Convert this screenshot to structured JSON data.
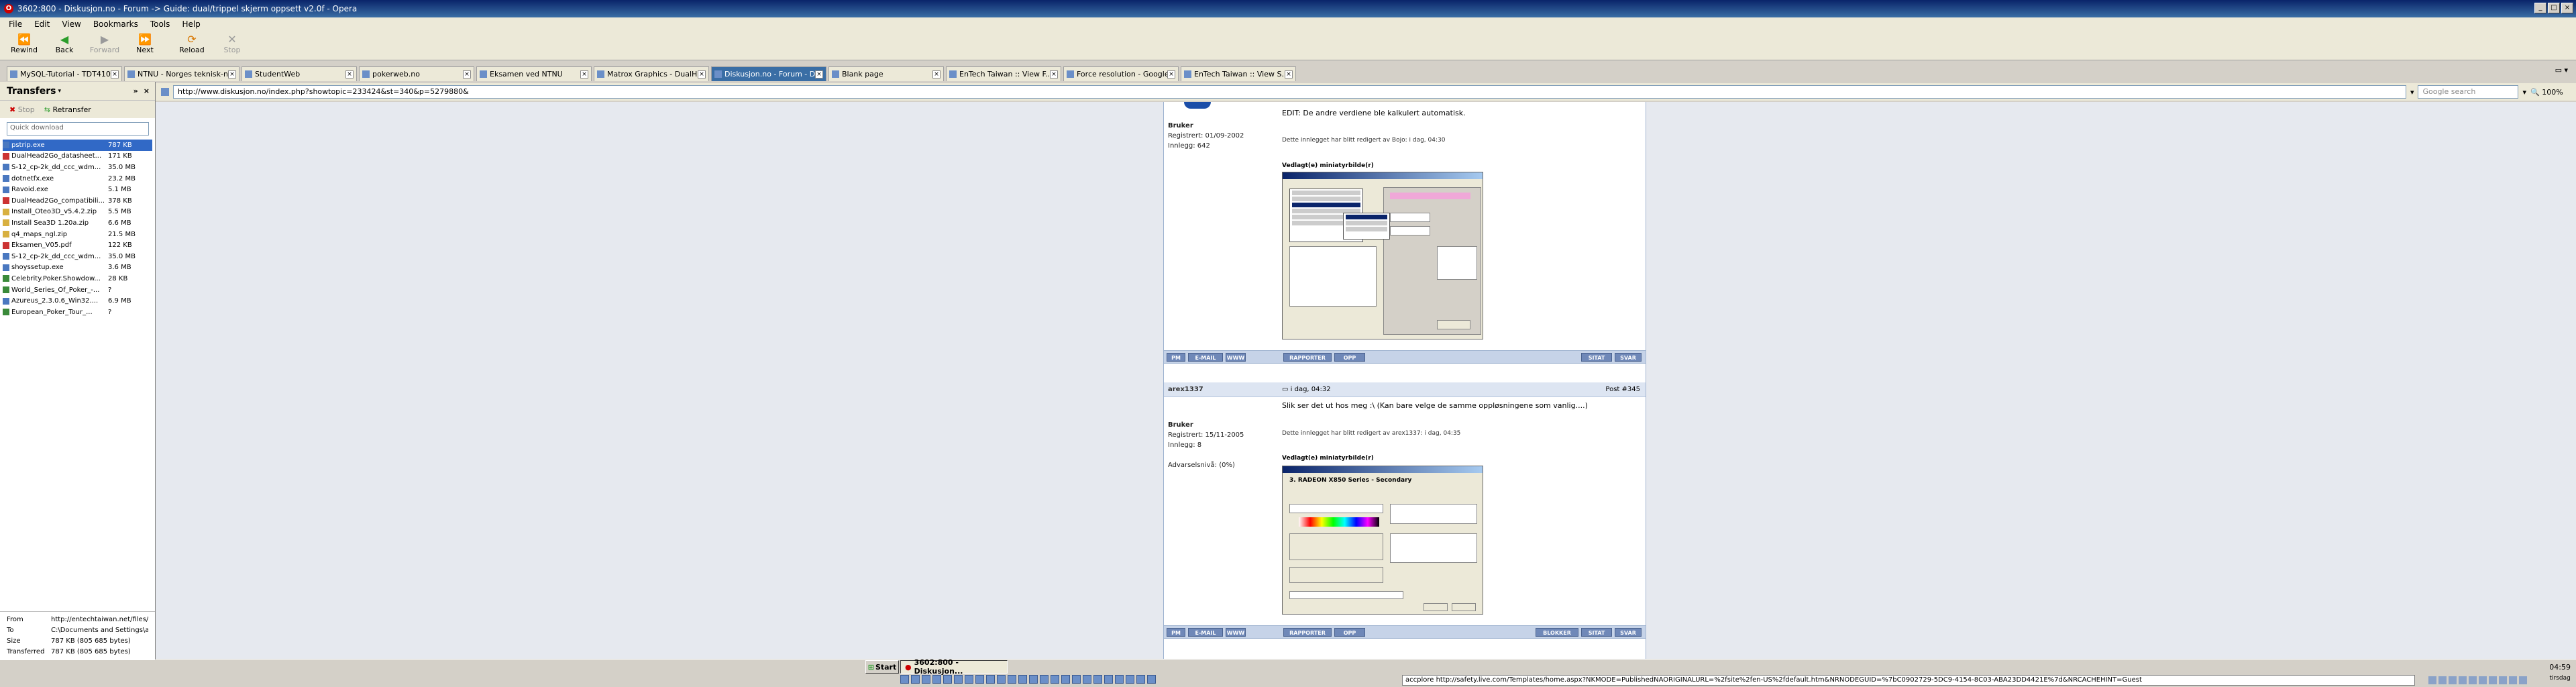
{
  "window": {
    "title": "3602:800 - Diskusjon.no - Forum -> Guide: dual/trippel skjerm oppsett v2.0f - Opera"
  },
  "menu": [
    "File",
    "Edit",
    "View",
    "Bookmarks",
    "Tools",
    "Help"
  ],
  "toolbar": {
    "rewind": "Rewind",
    "back": "Back",
    "forward": "Forward",
    "next": "Next",
    "reload": "Reload",
    "stop": "Stop"
  },
  "tabs": [
    "MySQL-Tutorial - TDT410...",
    "NTNU - Norges teknisk-n...",
    "StudentWeb",
    "pokerweb.no",
    "Eksamen ved NTNU",
    "Matrox Graphics - DualH...",
    "Diskusjon.no - Forum - D...",
    "Blank page",
    "EnTech Taiwan :: View F...",
    "Force resolution - Google...",
    "EnTech Taiwan :: View S..."
  ],
  "transfers": {
    "title": "Transfers",
    "stop": "Stop",
    "retransfer": "Retransfer",
    "quick_download": "Quick download",
    "files": [
      {
        "name": "pstrip.exe",
        "size": "787 KB"
      },
      {
        "name": "DualHead2Go_datasheet...",
        "size": "171 KB"
      },
      {
        "name": "S-12_cp-2k_dd_ccc_wdm...",
        "size": "35.0 MB"
      },
      {
        "name": "dotnetfx.exe",
        "size": "23.2 MB"
      },
      {
        "name": "Ravoid.exe",
        "size": "5.1 MB"
      },
      {
        "name": "DualHead2Go_compatibili...",
        "size": "378 KB"
      },
      {
        "name": "Install_Oteo3D_v5.4.2.zip",
        "size": "5.5 MB"
      },
      {
        "name": "Install Sea3D 1.20a.zip",
        "size": "6.6 MB"
      },
      {
        "name": "q4_maps_ngl.zip",
        "size": "21.5 MB"
      },
      {
        "name": "Eksamen_V05.pdf",
        "size": "122 KB"
      },
      {
        "name": "S-12_cp-2k_dd_ccc_wdm...",
        "size": "35.0 MB"
      },
      {
        "name": "shoyssetup.exe",
        "size": "3.6 MB"
      },
      {
        "name": "Celebrity.Poker.Showdow...",
        "size": "28 KB"
      },
      {
        "name": "World_Series_Of_Poker_-...",
        "size": "?"
      },
      {
        "name": "Azureus_2.3.0.6_Win32....",
        "size": "6.9 MB"
      },
      {
        "name": "European_Poker_Tour_...",
        "size": "?"
      }
    ],
    "info": {
      "from_label": "From",
      "from": "http://entechtaiwan.net/files/p",
      "to_label": "To",
      "to": "C:\\Documents and Settings\\are",
      "size_label": "Size",
      "size": "787 KB (805 685 bytes)",
      "transferred_label": "Transferred",
      "transferred": "787 KB (805 685 bytes)"
    }
  },
  "address": {
    "url": "http://www.diskusjon.no/index.php?showtopic=233424&st=340&p=5279880&",
    "search_placeholder": "Google search",
    "zoom": "100%"
  },
  "post1": {
    "edit_text": "EDIT: De andre verdiene ble kalkulert automatisk.",
    "role": "Bruker",
    "registered": "Registrert: 01/09-2002",
    "posts": "Innlegg: 642",
    "edited_note": "Dette innlegget har blitt redigert av Bojo: i dag, 04:30",
    "attach": "Vedlagt(e) miniatyrbilde(r)"
  },
  "post2": {
    "username": "arex1337",
    "time": "i dag, 04:32",
    "postnr": "Post #345",
    "text": "Slik ser det ut hos meg :\\ (Kan bare velge de samme oppløsningene som vanlig....)",
    "role": "Bruker",
    "registered": "Registrert: 15/11-2005",
    "posts": "Innlegg: 8",
    "warn": "Advarselsnivå: (0%)",
    "edited_note": "Dette innlegget har blitt redigert av arex1337: i dag, 04:35",
    "attach": "Vedlagt(e) miniatyrbilde(r)",
    "screenshot_title": "3. RADEON X850 Series - Secondary"
  },
  "buttons": {
    "pm": "PM",
    "e_mail": "E-MAIL",
    "www": "WWW",
    "rapporter": "RAPPORTER",
    "opp": "OPP",
    "sitat": "SITAT",
    "svar": "SVAR",
    "blokker": "BLOKKER"
  },
  "taskbar": {
    "start": "Start",
    "task": "3602:800 - Diskusjon...",
    "status_url": "accplore http://safety.live.com/Templates/home.aspx?NKMODE=PublishedNAORIGINALURL=%2fsite%2fen-US%2fdefault.htm&NRNODEGUID=%7bC0902729-5DC9-4154-8C03-ABA23DD4421E%7d&NRCACHEHINT=Guest",
    "clock_time": "04:59",
    "clock_day": "tirsdag"
  }
}
